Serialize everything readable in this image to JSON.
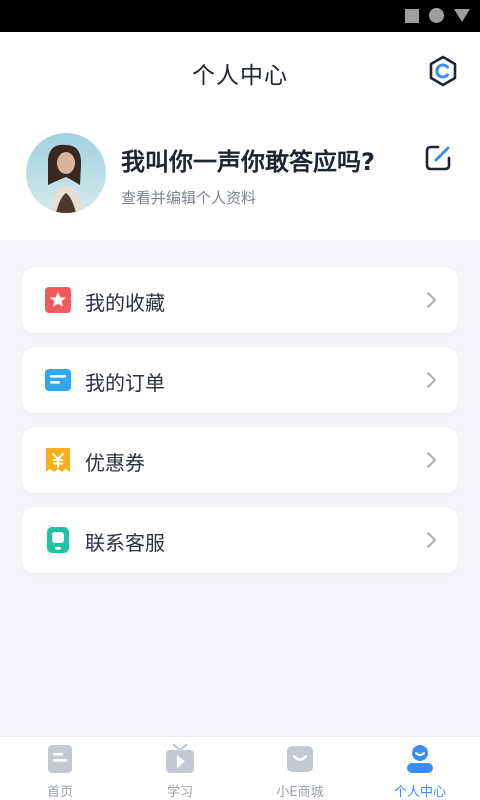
{
  "header": {
    "title": "个人中心"
  },
  "profile": {
    "nickname": "我叫你一声你敢答应吗?",
    "subtitle": "查看并编辑个人资料"
  },
  "menu": {
    "items": [
      {
        "label": "我的收藏",
        "icon": "star-icon",
        "color": "#f05a5a"
      },
      {
        "label": "我的订单",
        "icon": "order-icon",
        "color": "#2fa8f0"
      },
      {
        "label": "优惠券",
        "icon": "coupon-icon",
        "color": "#f6b01e"
      },
      {
        "label": "联系客服",
        "icon": "customer-service-icon",
        "color": "#1fc3a1"
      }
    ]
  },
  "tabbar": {
    "items": [
      {
        "label": "首页",
        "icon": "home-icon",
        "active": false
      },
      {
        "label": "学习",
        "icon": "video-icon",
        "active": false
      },
      {
        "label": "小E商城",
        "icon": "shop-icon",
        "active": false
      },
      {
        "label": "个人中心",
        "icon": "profile-icon",
        "active": true
      }
    ]
  },
  "colors": {
    "accent": "#3c8cf8",
    "background": "#f5f6fa",
    "card": "#ffffff",
    "inactive": "#c5c9d1"
  }
}
